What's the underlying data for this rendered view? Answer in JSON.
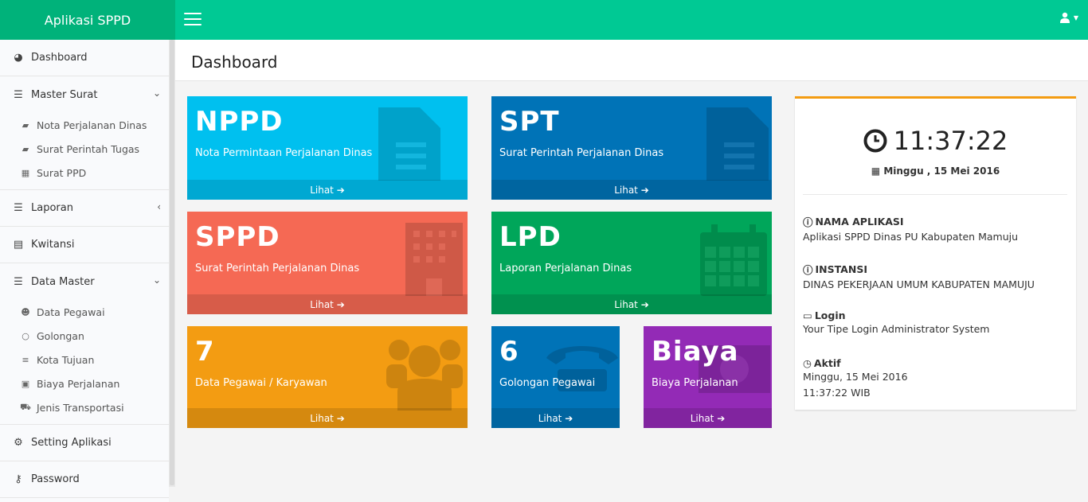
{
  "app": {
    "title": "Aplikasi SPPD"
  },
  "page": {
    "title": "Dashboard"
  },
  "sidebar": {
    "dashboard": "Dashboard",
    "master_surat": "Master Surat",
    "master_surat_items": [
      "Nota Perjalanan Dinas",
      "Surat Perintah Tugas",
      "Surat PPD"
    ],
    "laporan": "Laporan",
    "kwitansi": "Kwitansi",
    "data_master": "Data Master",
    "data_master_items": [
      "Data Pegawai",
      "Golongan",
      "Kota Tujuan",
      "Biaya Perjalanan",
      "Jenis Transportasi"
    ],
    "setting": "Setting Aplikasi",
    "password": "Password"
  },
  "tiles": [
    {
      "big": "NPPD",
      "desc": "Nota Permintaan Perjalanan Dinas",
      "link": "Lihat",
      "color": "#00c0ef"
    },
    {
      "big": "SPT",
      "desc": "Surat Perintah Perjalanan Dinas",
      "link": "Lihat",
      "color": "#0073b7"
    },
    {
      "big": "SPPD",
      "desc": "Surat Perintah Perjalanan Dinas",
      "link": "Lihat",
      "color": "#f56954"
    },
    {
      "big": "LPD",
      "desc": "Laporan Perjalanan Dinas",
      "link": "Lihat",
      "color": "#00a65a"
    },
    {
      "big": "7",
      "desc": "Data Pegawai / Karyawan",
      "link": "Lihat",
      "color": "#f39c12"
    },
    {
      "big": "6",
      "desc": "Golongan Pegawai",
      "link": "Lihat",
      "color": "#0073b7"
    },
    {
      "big": "Biaya",
      "desc": "Biaya Perjalanan",
      "link": "Lihat",
      "color": "#932ab6"
    }
  ],
  "info": {
    "time": "11:37:22",
    "date": "Minggu , 15 Mei 2016",
    "nama_label": "NAMA APLIKASI",
    "nama_value": "Aplikasi SPPD Dinas PU Kabupaten Mamuju",
    "instansi_label": "INSTANSI",
    "instansi_value": "DINAS PEKERJAAN UMUM KABUPATEN MAMUJU",
    "login_label": "Login",
    "login_value": "Your Tipe Login Administrator System",
    "aktif_label": "Aktif",
    "aktif_date": "Minggu, 15 Mei 2016",
    "aktif_time": "11:37:22 WIB"
  }
}
